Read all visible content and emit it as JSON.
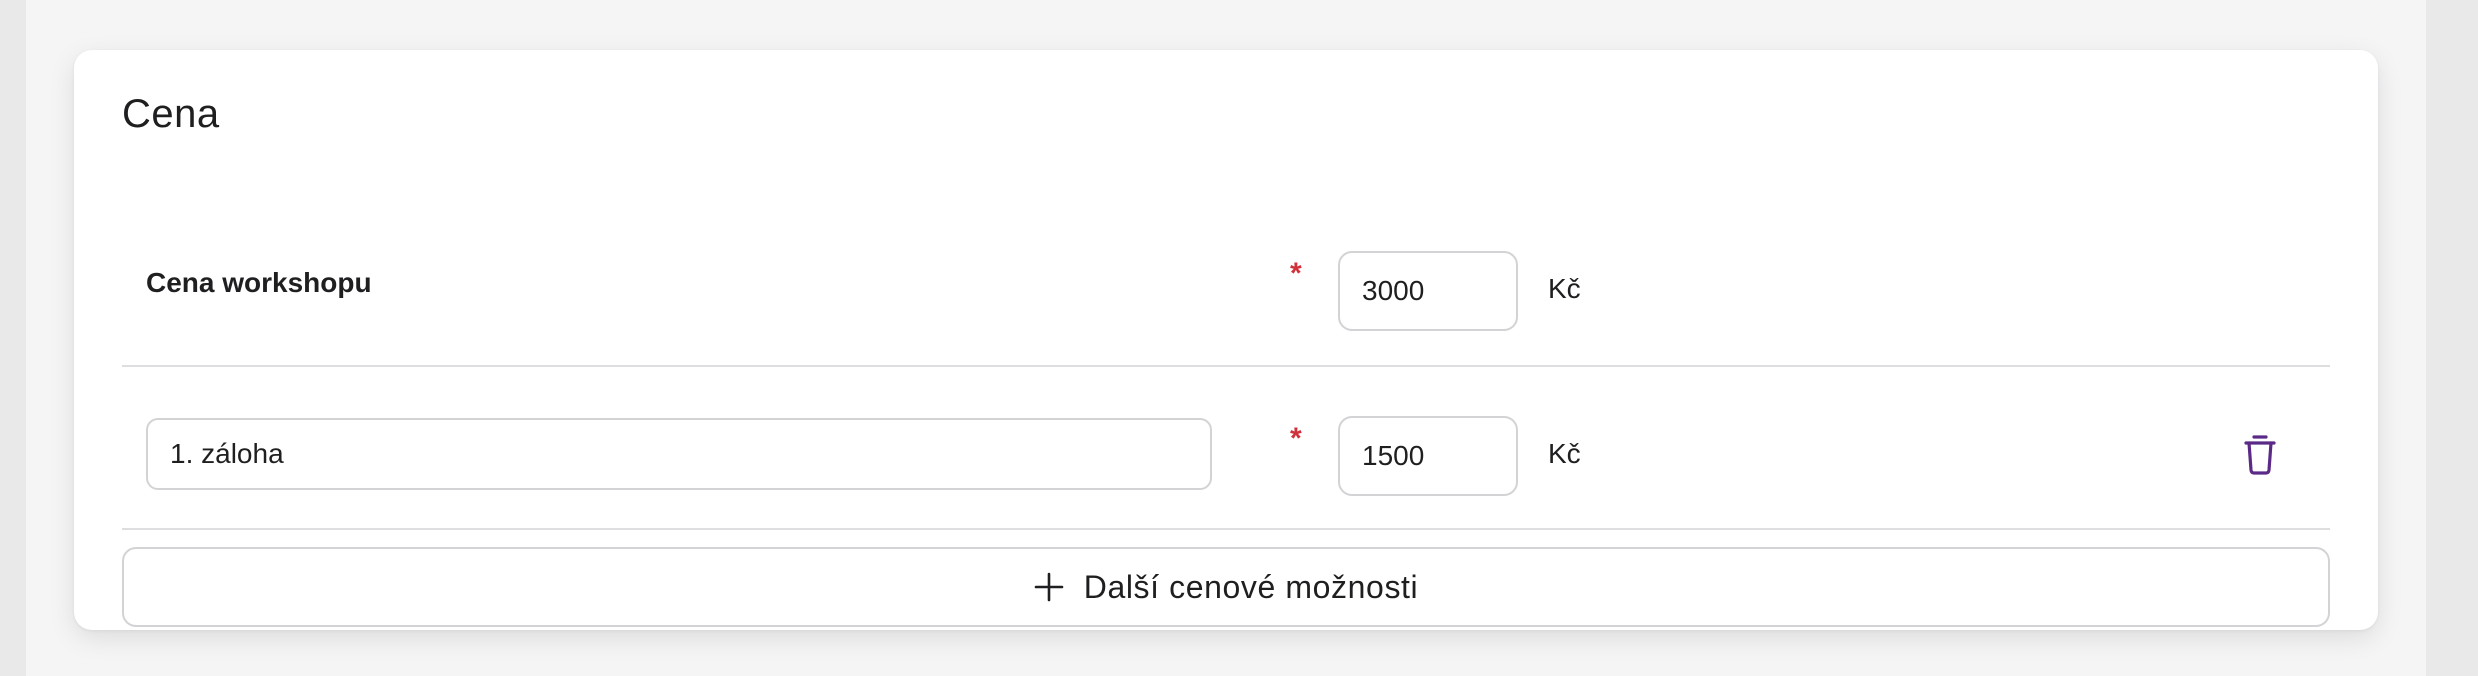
{
  "section": {
    "title": "Cena"
  },
  "rows": [
    {
      "label": "Cena workshopu",
      "required_mark": "*",
      "price": "3000",
      "currency": "Kč"
    },
    {
      "name_value": "1. záloha",
      "required_mark": "*",
      "price": "1500",
      "currency": "Kč",
      "delete_icon": "trash-icon"
    }
  ],
  "add_button": {
    "label": "Další cenové možnosti",
    "icon": "plus-icon"
  },
  "colors": {
    "required": "#d0313b",
    "accent_icon": "#5b2a86",
    "border": "#d3d3d6"
  }
}
